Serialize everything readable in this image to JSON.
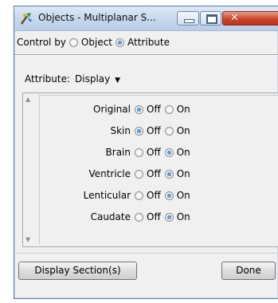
{
  "window": {
    "title": "Objects - Multiplanar S...",
    "close_glyph": "✕"
  },
  "control_by": {
    "label": "Control by",
    "options": [
      {
        "label": "Object",
        "checked": false
      },
      {
        "label": "Attribute",
        "checked": true
      }
    ]
  },
  "attribute": {
    "label": "Attribute:",
    "value": "Display"
  },
  "objects": [
    {
      "name": "Original",
      "off_label": "Off",
      "on_label": "On",
      "state": "Off"
    },
    {
      "name": "Skin",
      "off_label": "Off",
      "on_label": "On",
      "state": "Off"
    },
    {
      "name": "Brain",
      "off_label": "Off",
      "on_label": "On",
      "state": "On"
    },
    {
      "name": "Ventricle",
      "off_label": "Off",
      "on_label": "On",
      "state": "On"
    },
    {
      "name": "Lenticular",
      "off_label": "Off",
      "on_label": "On",
      "state": "On"
    },
    {
      "name": "Caudate",
      "off_label": "Off",
      "on_label": "On",
      "state": "On"
    }
  ],
  "buttons": {
    "display_sections": "Display Section(s)",
    "done": "Done"
  },
  "icons": {
    "app": "tool-icon",
    "scroll_up": "scroll-up-arrow-icon",
    "scroll_down": "scroll-down-arrow-icon"
  }
}
